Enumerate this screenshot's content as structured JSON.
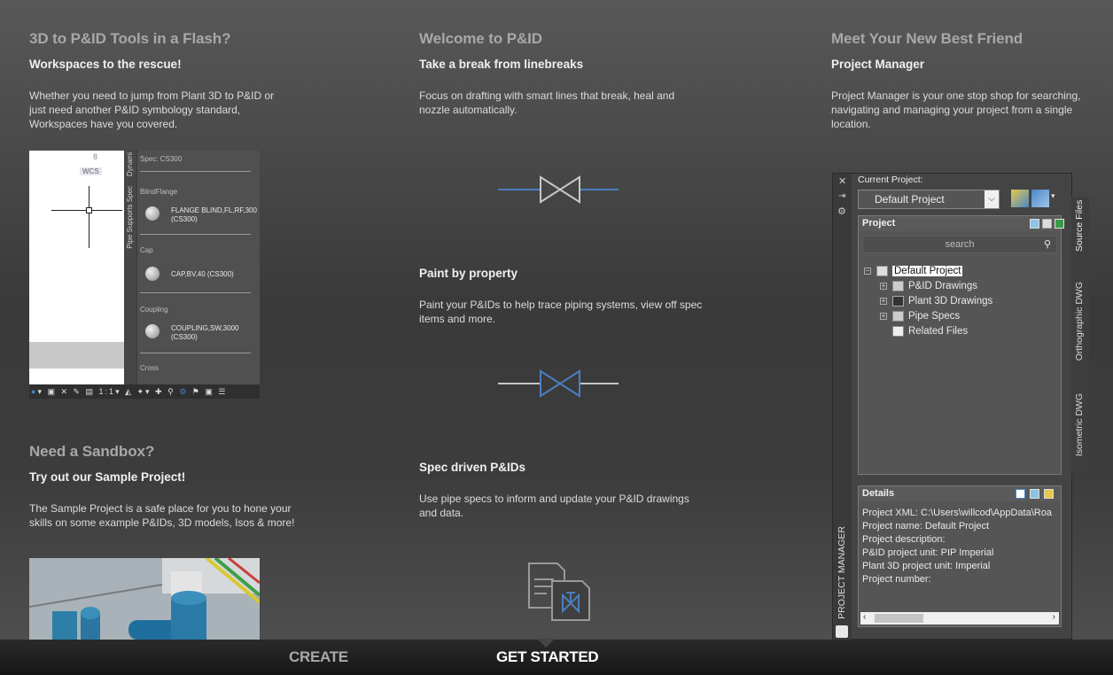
{
  "columns": {
    "left": {
      "title": "3D to P&ID Tools in a Flash?",
      "subtitle": "Workspaces to the rescue!",
      "body": "Whether you need to jump from Plant 3D to P&ID or just need another P&ID symbology standard, Workspaces have you covered."
    },
    "middle": {
      "title": "Welcome to P&ID",
      "subtitle": "Take a break from linebreaks",
      "body": "Focus on drafting with smart lines that break, heal and nozzle automatically."
    },
    "right": {
      "title": "Meet Your New Best Friend",
      "subtitle": "Project Manager",
      "body": "Project Manager is your one stop shop for searching, navigating and managing your project from a single location."
    },
    "sandbox": {
      "title": "Need a Sandbox?",
      "subtitle": "Try out our Sample Project!",
      "body": "The Sample Project is a safe place for you to hone your skills on some example P&IDs, 3D models, Isos & more!"
    },
    "paint": {
      "subtitle": "Paint by property",
      "body": "Paint your P&IDs to help trace piping systems, view off spec items and more."
    },
    "spec": {
      "subtitle": "Spec driven P&IDs",
      "body": "Use pipe specs to inform and update your P&ID drawings and data."
    }
  },
  "workspace": {
    "view_number": "8",
    "wcs": "WCS",
    "tabs": [
      "Dynami",
      "Pipe Supports Spec"
    ],
    "spec": "Spec: CS300",
    "categories": [
      {
        "name": "BlindFlange",
        "item": "FLANGE BLIND,FL,RF,300 (CS300)"
      },
      {
        "name": "Cap",
        "item": "CAP,BV,40 (CS300)"
      },
      {
        "name": "Coupling",
        "item": "COUPLING,SW,3000 (CS300)"
      },
      {
        "name": "Cross",
        "item": ""
      }
    ],
    "toolbar_scale": "1:1"
  },
  "project_manager": {
    "current_project_label": "Current Project:",
    "current_project": "Default Project",
    "project_header": "Project",
    "search_placeholder": "search",
    "tree": [
      {
        "label": "Default Project"
      },
      {
        "label": "P&ID Drawings"
      },
      {
        "label": "Plant 3D Drawings"
      },
      {
        "label": "Pipe Specs"
      },
      {
        "label": "Related Files"
      }
    ],
    "details_header": "Details",
    "details": [
      "Project XML:  C:\\Users\\willcod\\AppData\\Roa",
      "Project name: Default Project",
      "Project description:",
      "P&ID project unit: PIP Imperial",
      "Plant 3D project unit: Imperial",
      "Project number:"
    ],
    "vertical_label": "PROJECT MANAGER",
    "side_tabs": [
      "Source Files",
      "Orthographic DWG",
      "Isometric DWG"
    ]
  },
  "bottom_tabs": [
    {
      "label": "CREATE",
      "active": false
    },
    {
      "label": "GET STARTED",
      "active": true
    }
  ],
  "colors": {
    "accent_blue": "#4a7fbf",
    "valve_gray": "#c8c8c8"
  }
}
